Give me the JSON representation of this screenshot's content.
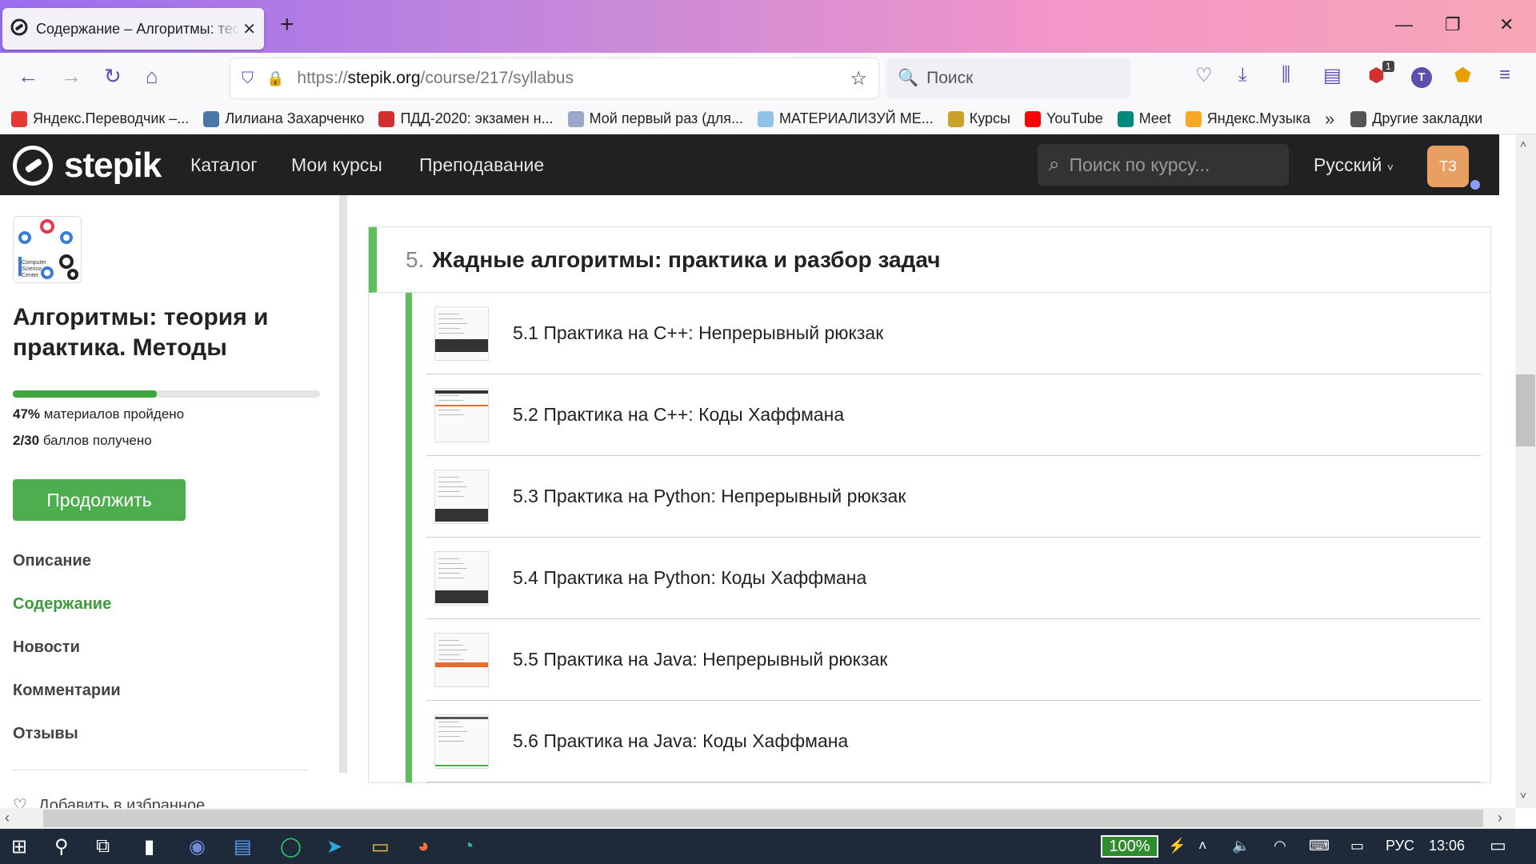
{
  "browser": {
    "tab_title": "Содержание – Алгоритмы: теория и практика. Методы",
    "url_scheme": "https://",
    "url_host": "stepik.org",
    "url_path": "/course/217/syllabus",
    "search_placeholder": "Поиск",
    "abp_badge": "1",
    "profile_letter": "T"
  },
  "bookmarks": [
    {
      "label": "Яндекс.Переводчик –...",
      "color": "#e53935"
    },
    {
      "label": "Лилиана Захарченко",
      "color": "#4a76a8"
    },
    {
      "label": "ПДД-2020: экзамен н...",
      "color": "#d32f2f"
    },
    {
      "label": "Мой первый раз (для...",
      "color": "#9aa7c9"
    },
    {
      "label": "МАТЕРИАЛИЗУЙ МЕ...",
      "color": "#8fc3e8"
    },
    {
      "label": "Курсы",
      "color": "#c9a227"
    },
    {
      "label": "YouTube",
      "color": "#ff0000"
    },
    {
      "label": "Meet",
      "color": "#00897b"
    },
    {
      "label": "Яндекс.Музыка",
      "color": "#f9a825"
    },
    {
      "label": "Другие закладки",
      "color": "#555555"
    }
  ],
  "header": {
    "logo_text": "stepik",
    "nav": [
      "Каталог",
      "Мои курсы",
      "Преподавание"
    ],
    "search_placeholder": "Поиск по курсу...",
    "language": "Русский",
    "avatar_initials": "ТЗ"
  },
  "sidebar": {
    "course_logo_text": "Computer Science Center",
    "course_title": "Алгоритмы: теория и практика. Методы",
    "progress_percent": 47,
    "progress_value": "47%",
    "progress_label": " материалов пройдено",
    "score_value": "2/30",
    "score_label": " баллов получено",
    "continue_label": "Продолжить",
    "nav": [
      "Описание",
      "Содержание",
      "Новости",
      "Комментарии",
      "Отзывы"
    ],
    "active_nav": "Содержание",
    "favorite_label": "Добавить в избранное"
  },
  "section": {
    "number": "5.",
    "title": "Жадные алгоритмы: практика и разбор задач",
    "lessons": [
      {
        "title": "5.1 Практика на C++: Непрерывный рюкзак"
      },
      {
        "title": "5.2 Практика на C++: Коды Хаффмана"
      },
      {
        "title": "5.3 Практика на Python: Непрерывный рюкзак"
      },
      {
        "title": "5.4 Практика на Python: Коды Хаффмана"
      },
      {
        "title": "5.5 Практика на Java: Непрерывный рюкзак"
      },
      {
        "title": "5.6 Практика на Java: Коды Хаффмана"
      }
    ]
  },
  "taskbar": {
    "battery": "100%",
    "language": "РУС",
    "time": "13:06"
  },
  "colors": {
    "accent_green": "#5cbf5c",
    "button_green": "#4cae4c",
    "header_bg": "#212121",
    "avatar_bg": "#e8a062"
  }
}
